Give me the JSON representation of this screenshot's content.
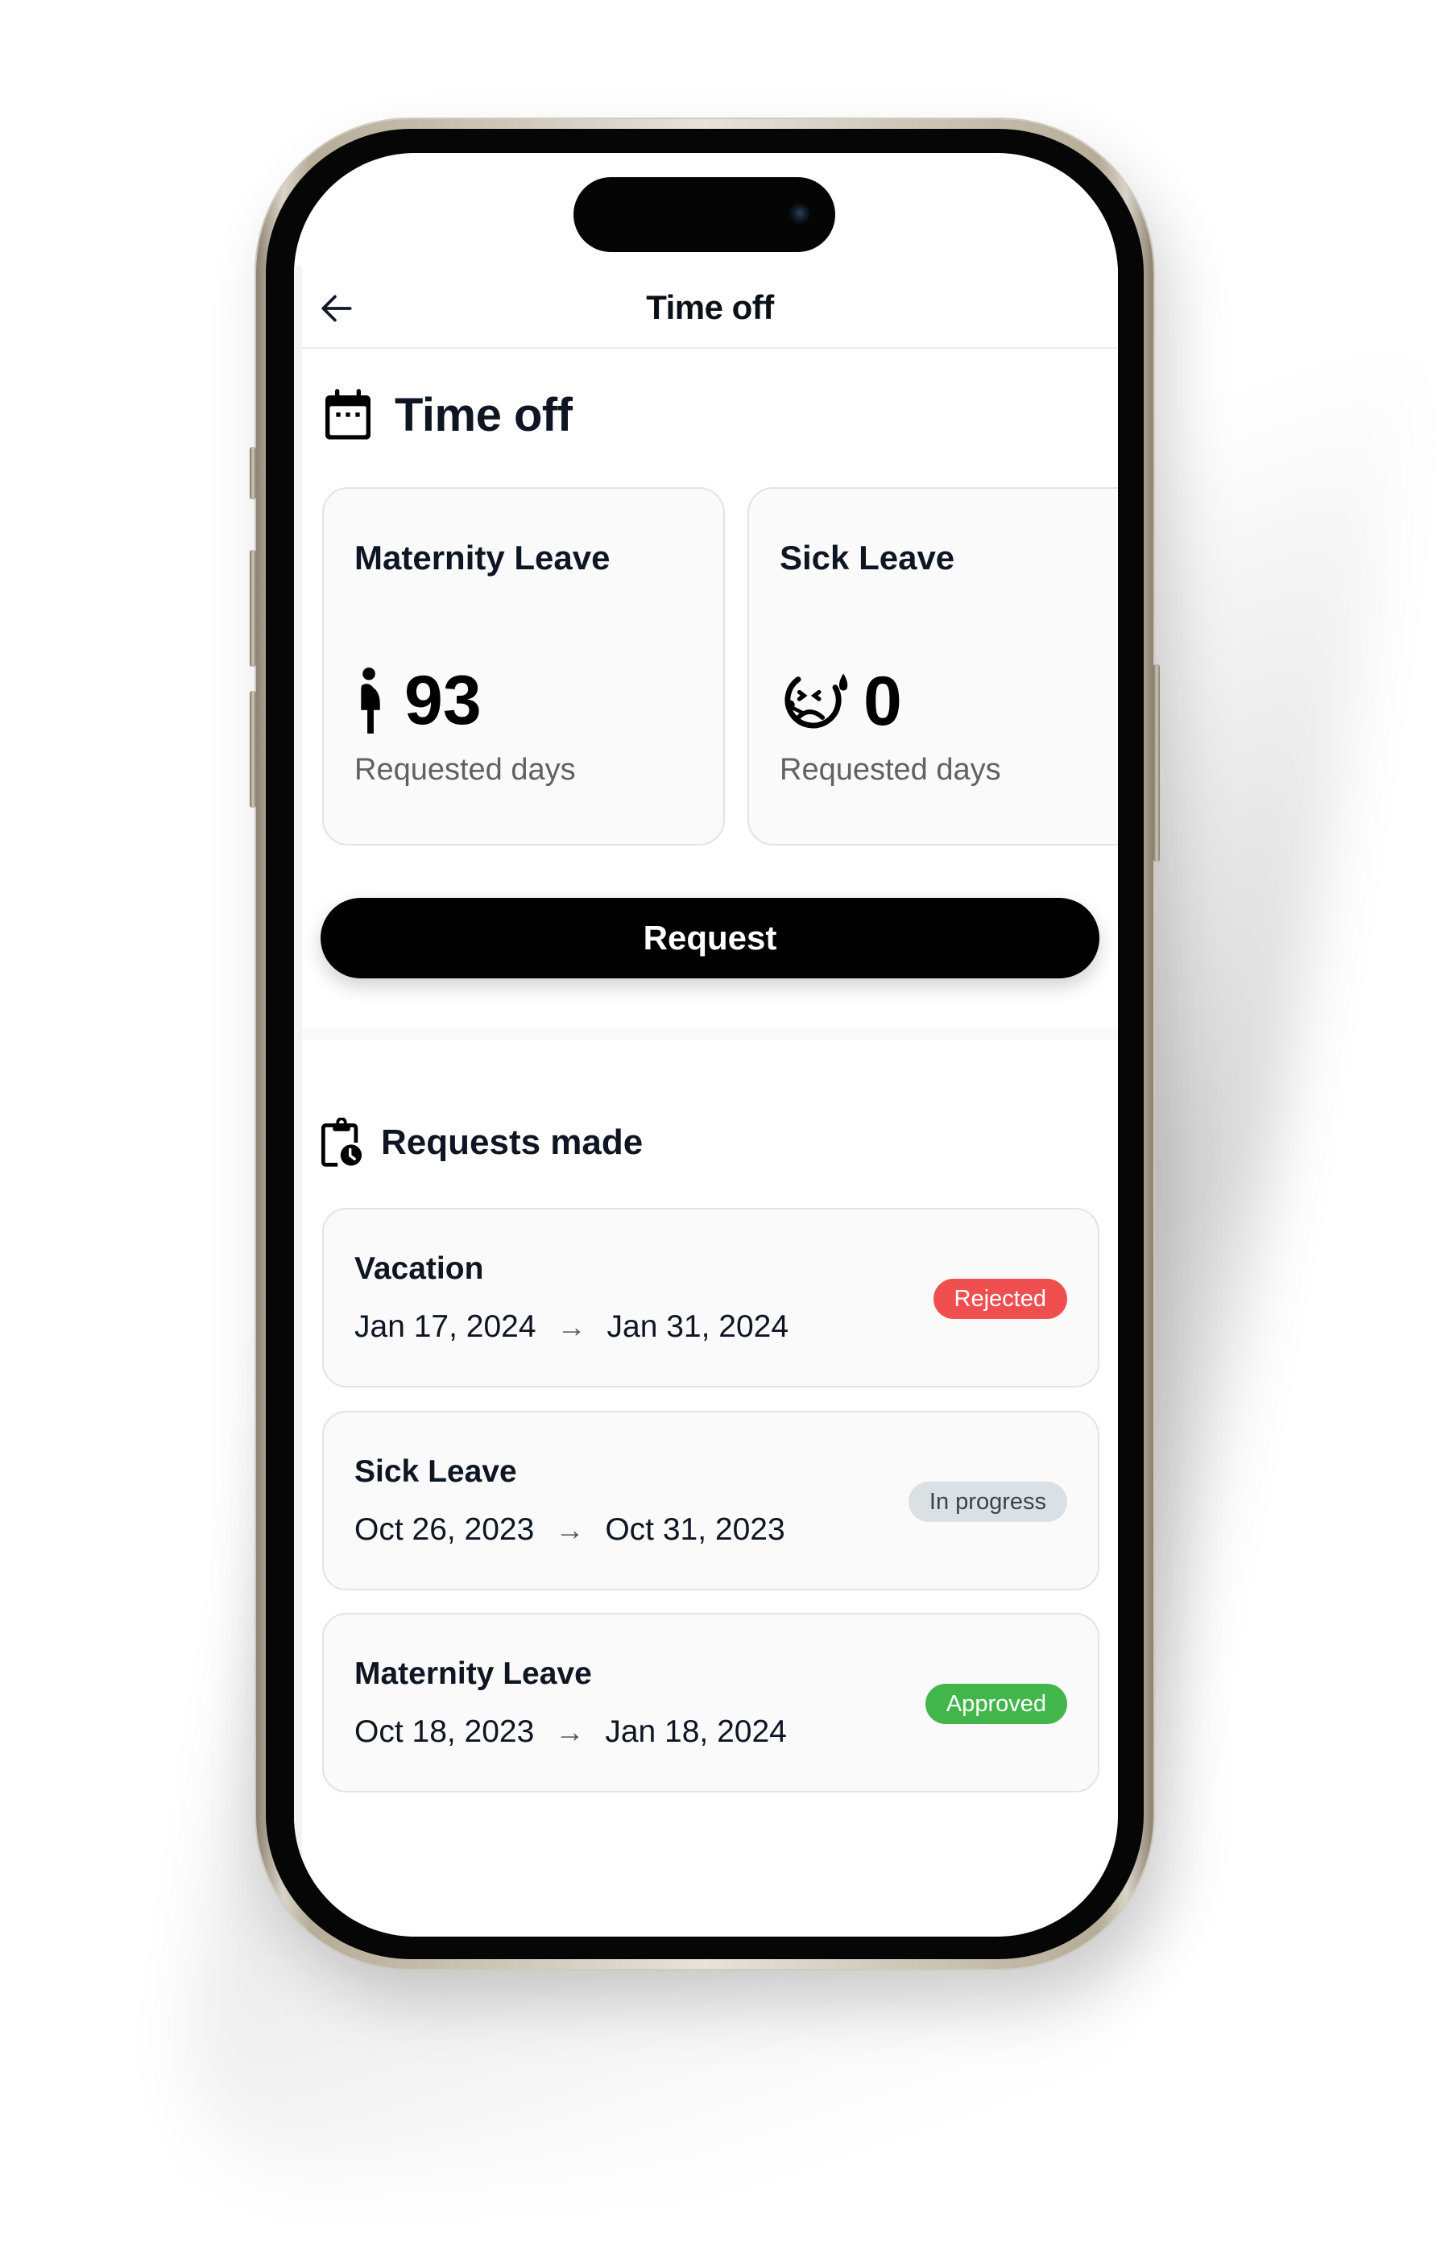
{
  "header": {
    "title": "Time off",
    "back_icon": "arrow-left-icon"
  },
  "time_off_section": {
    "title": "Time off",
    "icon": "calendar-icon",
    "cards": [
      {
        "name": "Maternity Leave",
        "icon": "pregnant-woman-icon",
        "count": "93",
        "subtitle": "Requested days"
      },
      {
        "name": "Sick Leave",
        "icon": "sick-face-icon",
        "count": "0",
        "subtitle": "Requested days"
      }
    ],
    "request_button": "Request"
  },
  "requests_section": {
    "title": "Requests made",
    "icon": "clipboard-clock-icon",
    "items": [
      {
        "type": "Vacation",
        "start": "Jan 17, 2024",
        "end": "Jan 31, 2024",
        "status": "Rejected",
        "status_color": "#ef4f4f"
      },
      {
        "type": "Sick Leave",
        "start": "Oct 26, 2023",
        "end": "Oct 31, 2023",
        "status": "In progress",
        "status_color": "#dbe0e4"
      },
      {
        "type": "Maternity Leave",
        "start": "Oct 18, 2023",
        "end": "Jan 18, 2024",
        "status": "Approved",
        "status_color": "#43b64b"
      }
    ],
    "arrow_glyph": "→"
  }
}
